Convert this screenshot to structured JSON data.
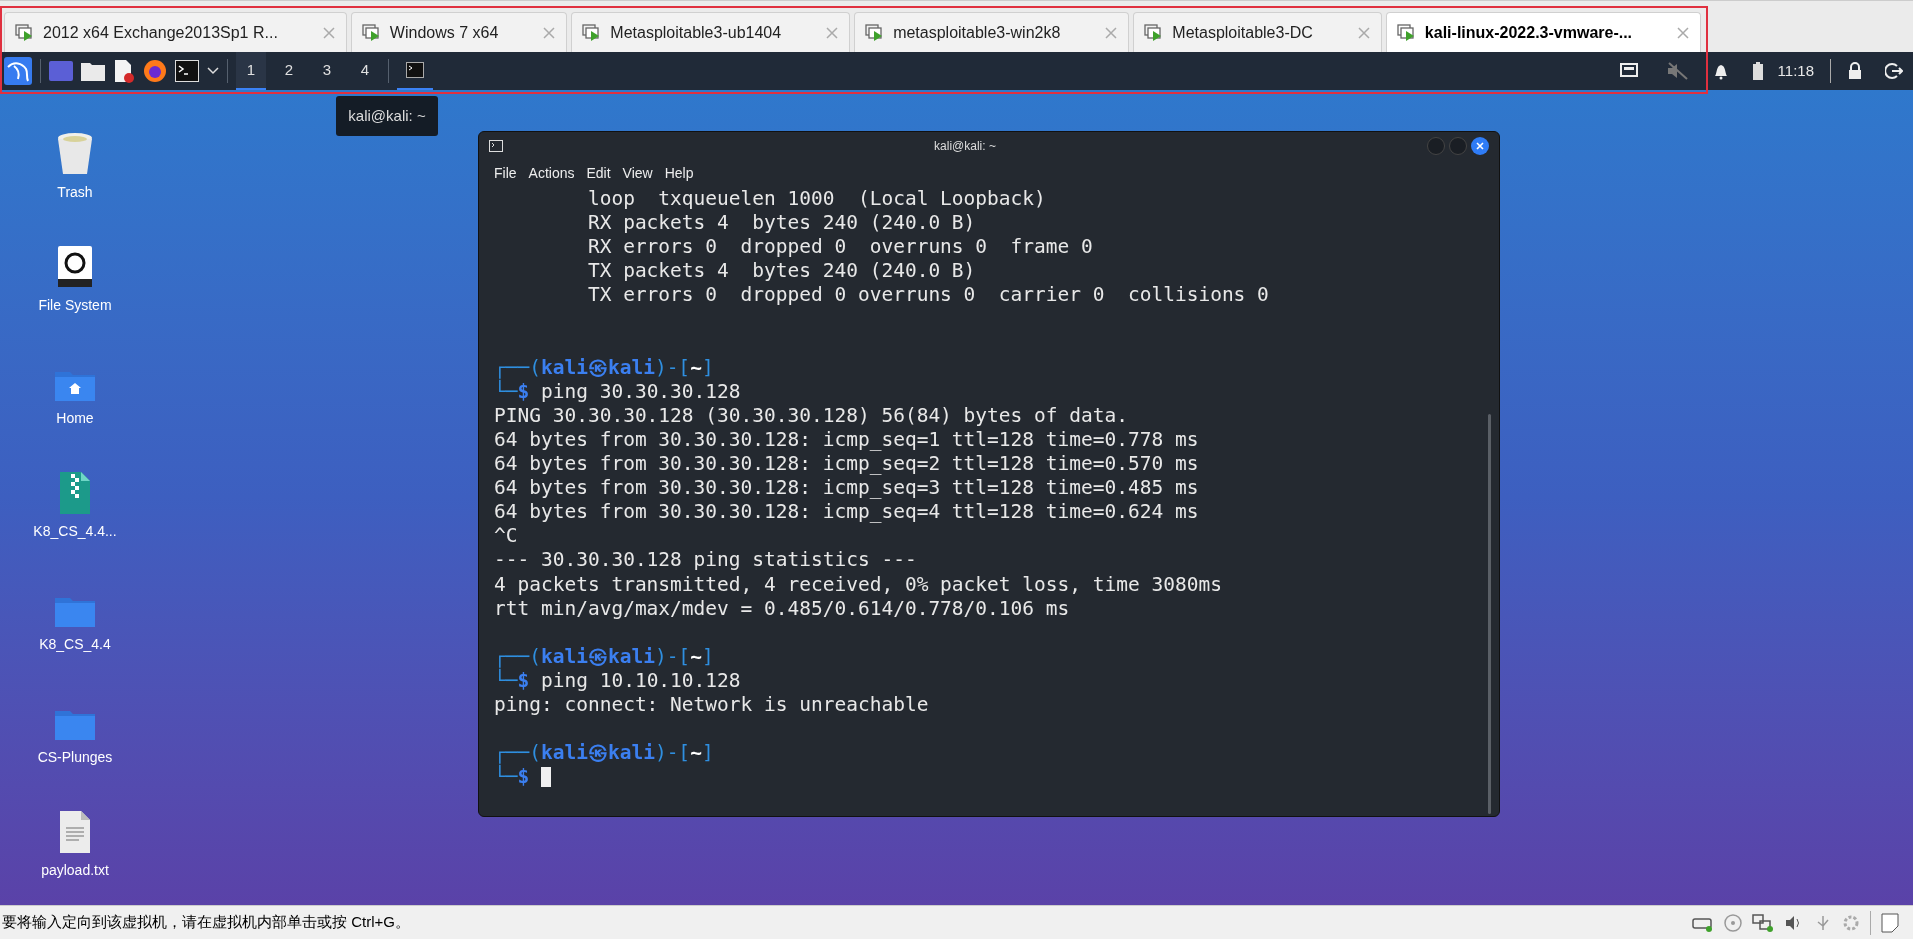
{
  "vm_tabs": [
    {
      "label": "2012 x64 Exchange2013Sp1 R...",
      "selected": false
    },
    {
      "label": "Windows 7 x64",
      "selected": false
    },
    {
      "label": "Metasploitable3-ub1404",
      "selected": false
    },
    {
      "label": "metasploitable3-win2k8",
      "selected": false
    },
    {
      "label": "Metasploitable3-DC",
      "selected": false
    },
    {
      "label": "kali-linux-2022.3-vmware-...",
      "selected": true
    }
  ],
  "panel": {
    "workspaces": [
      {
        "label": "1",
        "selected": true
      },
      {
        "label": "2",
        "selected": false
      },
      {
        "label": "3",
        "selected": false
      },
      {
        "label": "4",
        "selected": false
      }
    ],
    "clock": "11:18"
  },
  "tooltip": "kali@kali: ~",
  "desktop_icons": [
    {
      "label": "Trash",
      "kind": "trash"
    },
    {
      "label": "File System",
      "kind": "drive"
    },
    {
      "label": "Home",
      "kind": "home"
    },
    {
      "label": "K8_CS_4.4...",
      "kind": "archive"
    },
    {
      "label": "K8_CS_4.4",
      "kind": "folder"
    },
    {
      "label": "CS-Plunges",
      "kind": "folder"
    },
    {
      "label": "payload.txt",
      "kind": "text"
    }
  ],
  "terminal": {
    "title": "kali@kali: ~",
    "menu": [
      "File",
      "Actions",
      "Edit",
      "View",
      "Help"
    ],
    "lines": [
      {
        "kind": "output",
        "text": "        loop  txqueuelen 1000  (Local Loopback)"
      },
      {
        "kind": "output",
        "text": "        RX packets 4  bytes 240 (240.0 B)"
      },
      {
        "kind": "output",
        "text": "        RX errors 0  dropped 0  overruns 0  frame 0"
      },
      {
        "kind": "output",
        "text": "        TX packets 4  bytes 240 (240.0 B)"
      },
      {
        "kind": "output",
        "text": "        TX errors 0  dropped 0 overruns 0  carrier 0  collisions 0"
      },
      {
        "kind": "blank"
      },
      {
        "kind": "blank"
      },
      {
        "kind": "prompt_head",
        "open": "┌──(",
        "user": "kali㉿kali",
        "middle": ")-[",
        "path": "~",
        "close": "]"
      },
      {
        "kind": "prompt_command",
        "arrow": "└─",
        "symbol": "$",
        "command": " ping 30.30.30.128"
      },
      {
        "kind": "output",
        "text": "PING 30.30.30.128 (30.30.30.128) 56(84) bytes of data."
      },
      {
        "kind": "output",
        "text": "64 bytes from 30.30.30.128: icmp_seq=1 ttl=128 time=0.778 ms"
      },
      {
        "kind": "output",
        "text": "64 bytes from 30.30.30.128: icmp_seq=2 ttl=128 time=0.570 ms"
      },
      {
        "kind": "output",
        "text": "64 bytes from 30.30.30.128: icmp_seq=3 ttl=128 time=0.485 ms"
      },
      {
        "kind": "output",
        "text": "64 bytes from 30.30.30.128: icmp_seq=4 ttl=128 time=0.624 ms"
      },
      {
        "kind": "output",
        "text": "^C"
      },
      {
        "kind": "output",
        "text": "--- 30.30.30.128 ping statistics ---"
      },
      {
        "kind": "output",
        "text": "4 packets transmitted, 4 received, 0% packet loss, time 3080ms"
      },
      {
        "kind": "output",
        "text": "rtt min/avg/max/mdev = 0.485/0.614/0.778/0.106 ms"
      },
      {
        "kind": "blank"
      },
      {
        "kind": "prompt_head",
        "open": "┌──(",
        "user": "kali㉿kali",
        "middle": ")-[",
        "path": "~",
        "close": "]"
      },
      {
        "kind": "prompt_command",
        "arrow": "└─",
        "symbol": "$",
        "command": " ping 10.10.10.128"
      },
      {
        "kind": "output",
        "text": "ping: connect: Network is unreachable"
      },
      {
        "kind": "blank"
      },
      {
        "kind": "prompt_head",
        "open": "┌──(",
        "user": "kali㉿kali",
        "middle": ")-[",
        "path": "~",
        "close": "]"
      },
      {
        "kind": "prompt_command",
        "arrow": "└─",
        "symbol": "$",
        "cursor": true
      }
    ]
  },
  "status_bar": {
    "message": "要将输入定向到该虚拟机，请在虚拟机内部单击或按 Ctrl+G。"
  }
}
